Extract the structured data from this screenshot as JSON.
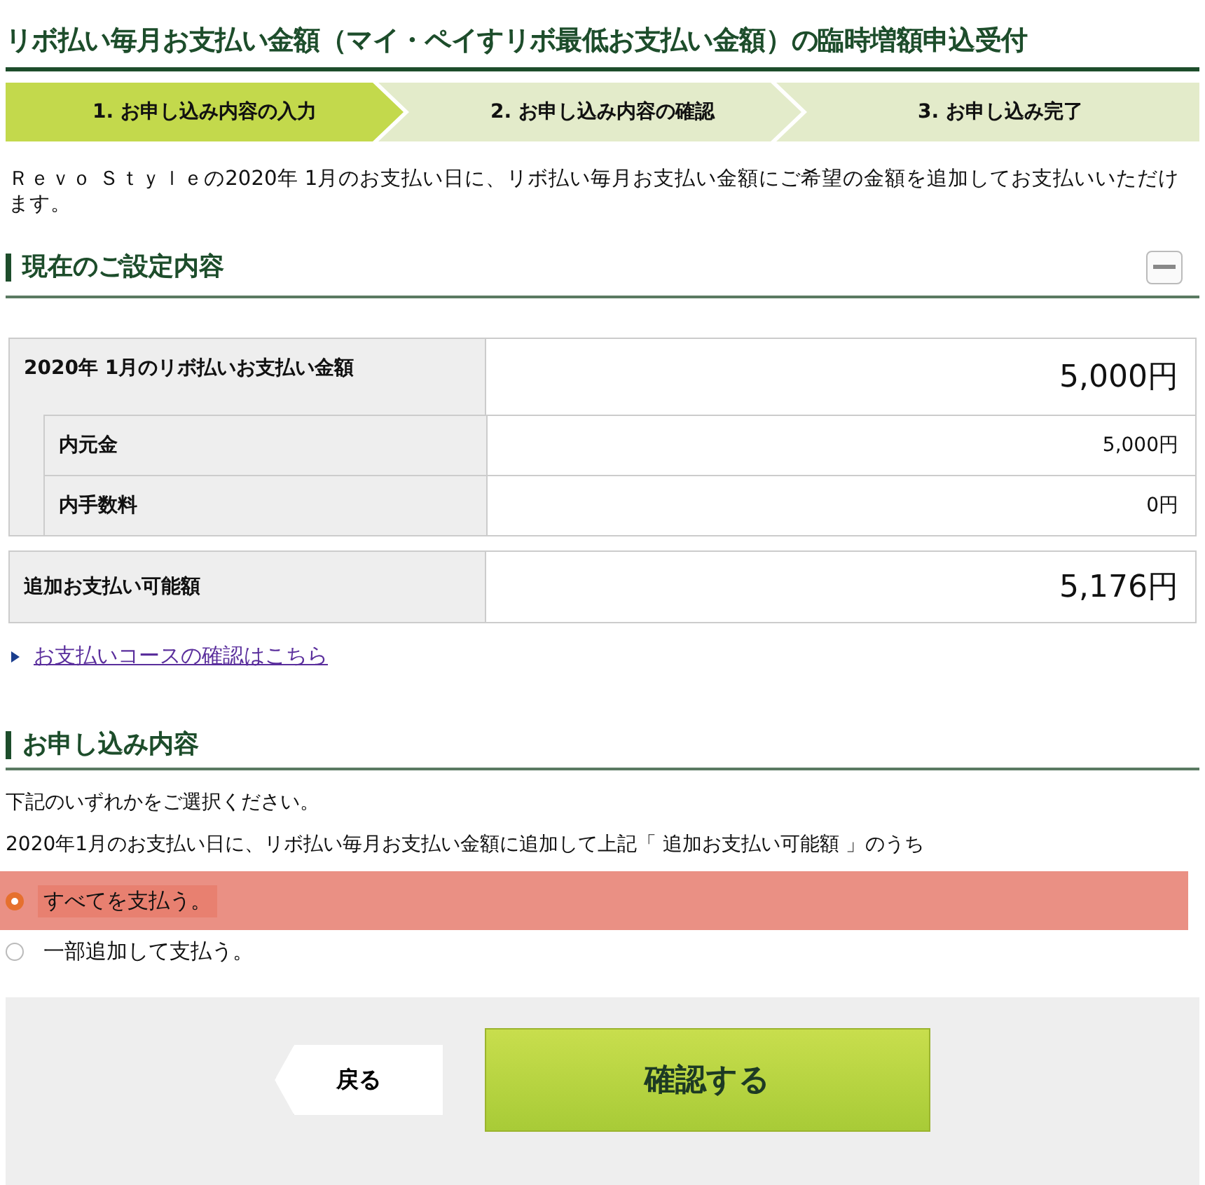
{
  "title": "リボ払い毎月お支払い金額（マイ・ペイすリボ最低お支払い金額）の臨時増額申込受付",
  "steps": [
    {
      "label": "1. お申し込み内容の入力",
      "selected": true
    },
    {
      "label": "2. お申し込み内容の確認",
      "selected": false
    },
    {
      "label": "3. お申し込み完了",
      "selected": false
    }
  ],
  "intro": "Ｒｅｖｏ Ｓｔｙｌｅの2020年 1月のお支払い日に、リボ払い毎月お支払い金額にご希望の金額を追加してお支払いいただけます。",
  "current_settings": {
    "heading": "現在のご設定内容",
    "expanded": true,
    "rows": [
      {
        "kind": "main",
        "label": "2020年 1月のリボ払いお支払い金額",
        "value": "5,000円"
      },
      {
        "kind": "sub",
        "label": "内元金",
        "value": "5,000円"
      },
      {
        "kind": "sub",
        "label": "内手数料",
        "value": "0円"
      }
    ],
    "available": {
      "label": "追加お支払い可能額",
      "value": "5,176円"
    },
    "link": "お支払いコースの確認はこちら"
  },
  "application": {
    "heading": "お申し込み内容",
    "instruction": "下記のいずれかをご選択ください。",
    "description": "2020年1月のお支払い日に、リボ払い毎月お支払い金額に追加して上記「 追加お支払い可能額 」のうち",
    "options": [
      {
        "label": "すべてを支払う。",
        "selected": true
      },
      {
        "label": "一部追加して支払う。",
        "selected": false
      }
    ]
  },
  "buttons": {
    "back": "戻る",
    "confirm": "確認する"
  }
}
